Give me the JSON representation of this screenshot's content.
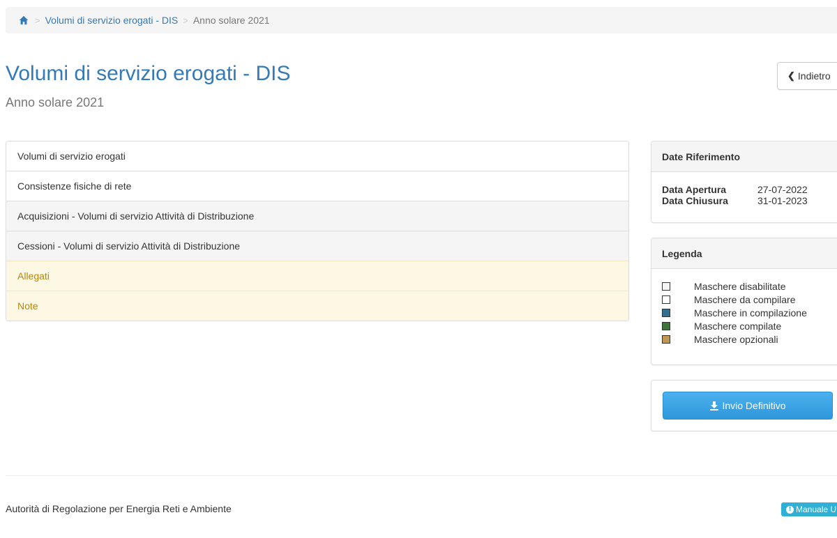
{
  "breadcrumb": {
    "parent": "Volumi di servizio erogati - DIS",
    "current": "Anno solare 2021",
    "separator": ">"
  },
  "page": {
    "title": "Volumi di servizio erogati - DIS",
    "subtitle": "Anno solare 2021",
    "back_label": "Indietro"
  },
  "masks": [
    {
      "label": "Volumi di servizio erogati",
      "status": "da compilare"
    },
    {
      "label": "Consistenze fisiche di rete",
      "status": "da compilare"
    },
    {
      "label": "Acquisizioni - Volumi di servizio Attività  di Distribuzione",
      "status": "disabilitata"
    },
    {
      "label": "Cessioni - Volumi di servizio Attività  di Distribuzione",
      "status": "disabilitata"
    },
    {
      "label": "Allegati",
      "status": "opzionale"
    },
    {
      "label": "Note",
      "status": "opzionale"
    }
  ],
  "dates": {
    "heading": "Date Riferimento",
    "opening_label": "Data Apertura",
    "opening_value": "27-07-2022",
    "closing_label": "Data Chiusura",
    "closing_value": "31-01-2023"
  },
  "legend": {
    "heading": "Legenda",
    "items": [
      {
        "label": "Maschere disabilitate",
        "color": "#f5f5f5"
      },
      {
        "label": "Maschere da compilare",
        "color": "#ffffff"
      },
      {
        "label": "Maschere in compilazione",
        "color": "#31708f"
      },
      {
        "label": "Maschere compilate",
        "color": "#3c763d"
      },
      {
        "label": "Maschere opzionali",
        "color": "#c09853"
      }
    ]
  },
  "submit": {
    "label": "Invio Definitivo"
  },
  "footer": {
    "organization": "Autorità di Regolazione per Energia Reti e Ambiente",
    "manual_label": "Manuale U"
  },
  "icons": {
    "home": "home-icon",
    "back": "chevron-left-icon",
    "download": "download-icon",
    "info": "info-circle-icon"
  },
  "colors": {
    "link": "#337ab7",
    "primary_button": "#3aa3e3",
    "info_button": "#31b0d5",
    "optional_row_bg": "#fcf8e3",
    "optional_row_text": "#b8860b"
  }
}
